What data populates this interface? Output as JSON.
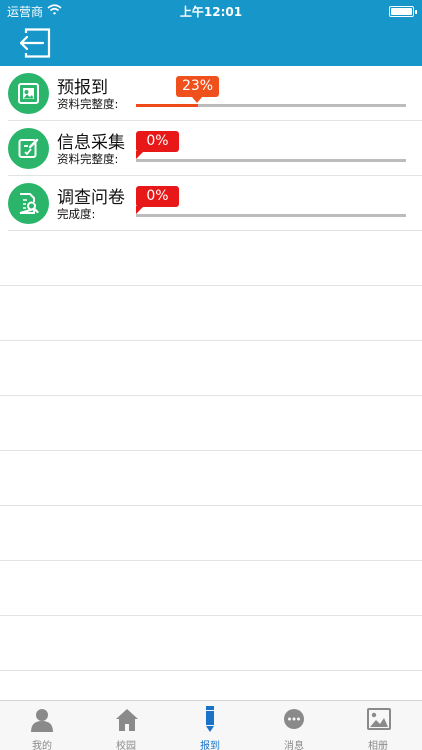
{
  "status_bar": {
    "carrier": "运营商",
    "time": "上午12:01"
  },
  "nav": {
    "back_icon": "back-arrow-icon"
  },
  "colors": {
    "header": "#1797c9",
    "green": "#2bb56b",
    "progress_orange": "#f0501c",
    "badge_red": "#e81818",
    "tab_active": "#1a73c9"
  },
  "items": [
    {
      "title": "预报到",
      "label": "资料完整度:",
      "percent_text": "23%",
      "progress": 0.23,
      "icon": "id-card-icon"
    },
    {
      "title": "信息采集",
      "label": "资料完整度:",
      "percent_text": "0%",
      "progress": 0,
      "icon": "edit-form-icon"
    },
    {
      "title": "调查问卷",
      "label": "完成度:",
      "percent_text": "0%",
      "progress": 0,
      "icon": "document-search-icon"
    }
  ],
  "tabs": [
    {
      "label": "我的",
      "icon": "person-icon",
      "active": false
    },
    {
      "label": "校园",
      "icon": "home-icon",
      "active": false
    },
    {
      "label": "报到",
      "icon": "pen-icon",
      "active": true
    },
    {
      "label": "消息",
      "icon": "chat-bubble-icon",
      "active": false
    },
    {
      "label": "相册",
      "icon": "picture-icon",
      "active": false
    }
  ]
}
